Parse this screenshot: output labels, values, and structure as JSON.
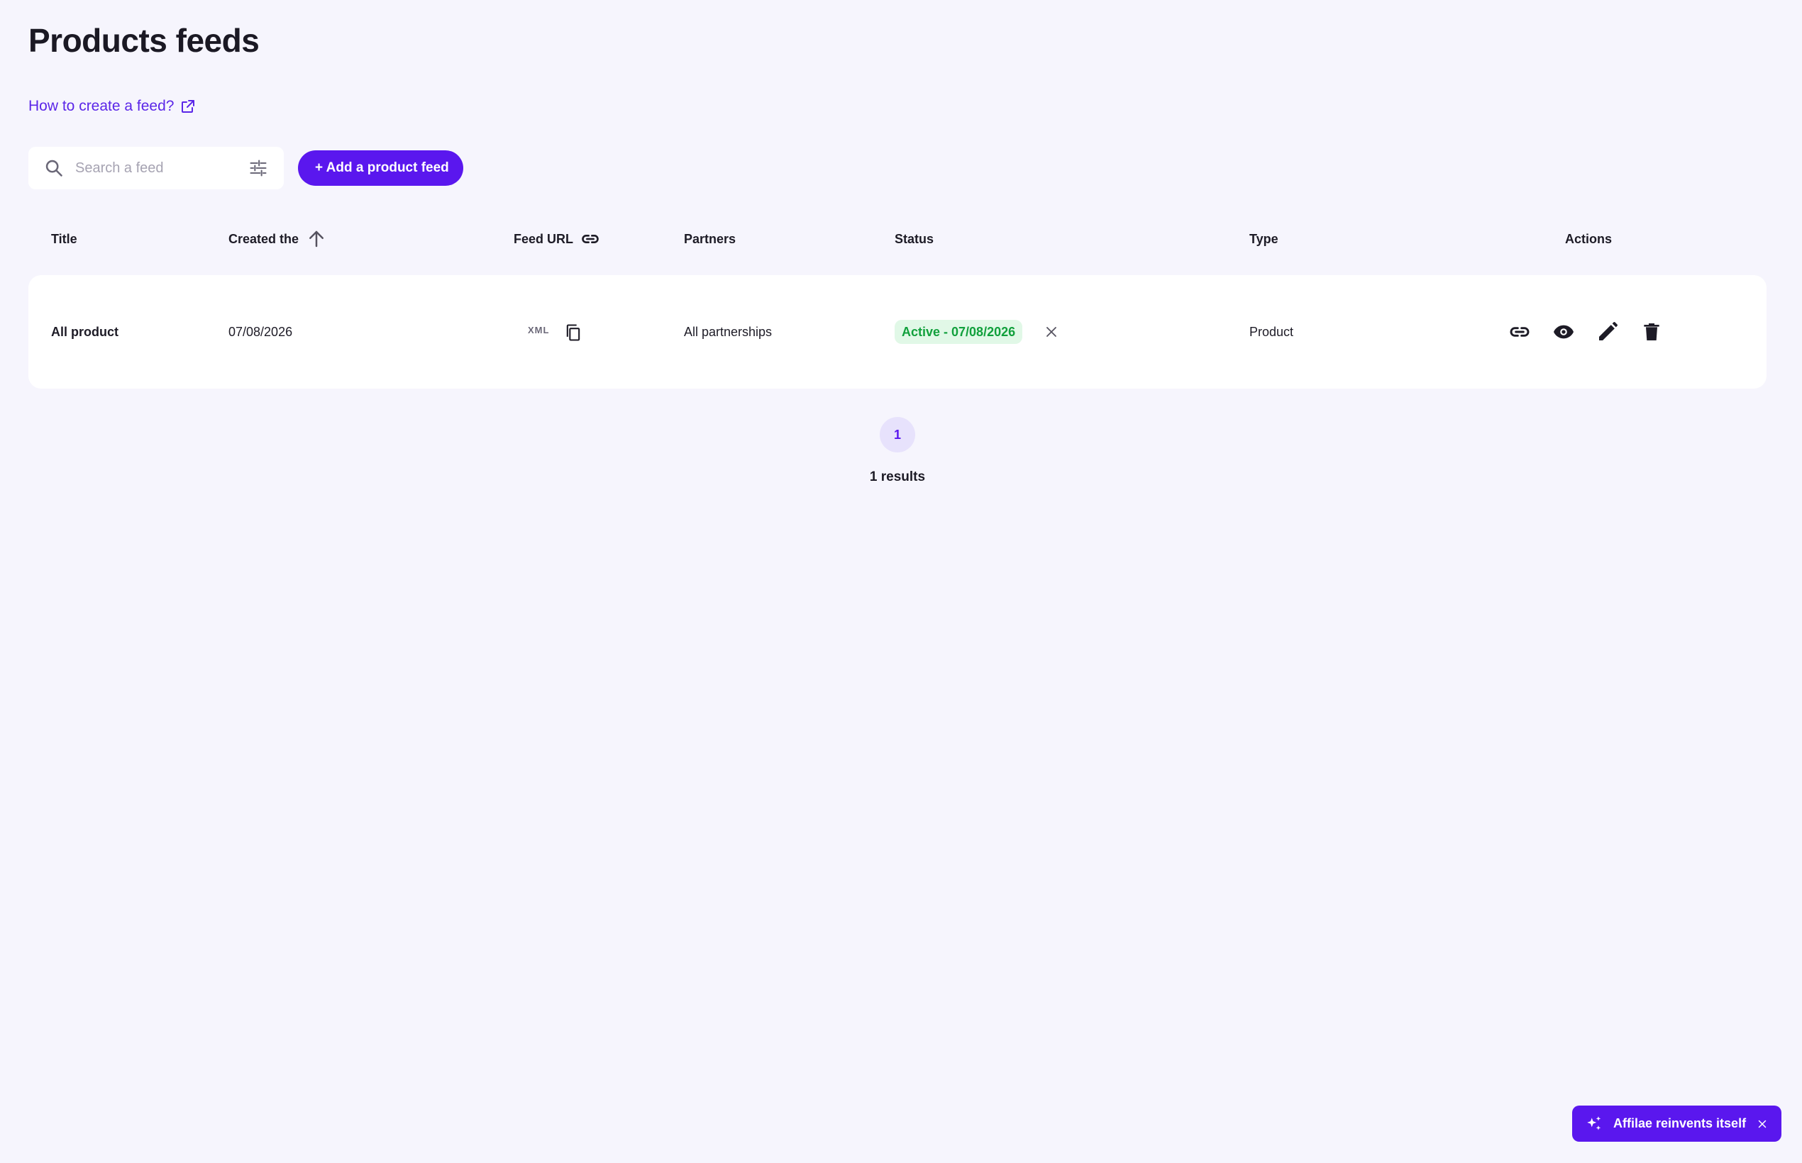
{
  "page": {
    "title": "Products feeds",
    "help_link": "How to create a feed?"
  },
  "toolbar": {
    "search_placeholder": "Search a feed",
    "add_button_label": "+ Add a product feed"
  },
  "table": {
    "columns": {
      "title": "Title",
      "created": "Created the",
      "feed_url": "Feed URL",
      "partners": "Partners",
      "status": "Status",
      "type": "Type",
      "actions": "Actions"
    },
    "rows": [
      {
        "title": "All product",
        "created": "07/08/2026",
        "feed_format": "XML",
        "partners": "All partnerships",
        "status": "Active - 07/08/2026",
        "type": "Product"
      }
    ]
  },
  "pagination": {
    "current_page": "1",
    "results": "1 results"
  },
  "promo": {
    "text": "Affilae reinvents itself"
  },
  "colors": {
    "background": "#f6f5fd",
    "accent": "#5a17ee",
    "status_active_bg": "#e1f8e7",
    "status_active_text": "#11a03c"
  },
  "icons": [
    "search-icon",
    "filter-icon",
    "plus-icon",
    "external-link-icon",
    "sort-arrow-up-icon",
    "link-icon",
    "copy-icon",
    "close-icon",
    "eye-icon",
    "edit-pencil-icon",
    "trash-icon",
    "sparkle-icon"
  ]
}
